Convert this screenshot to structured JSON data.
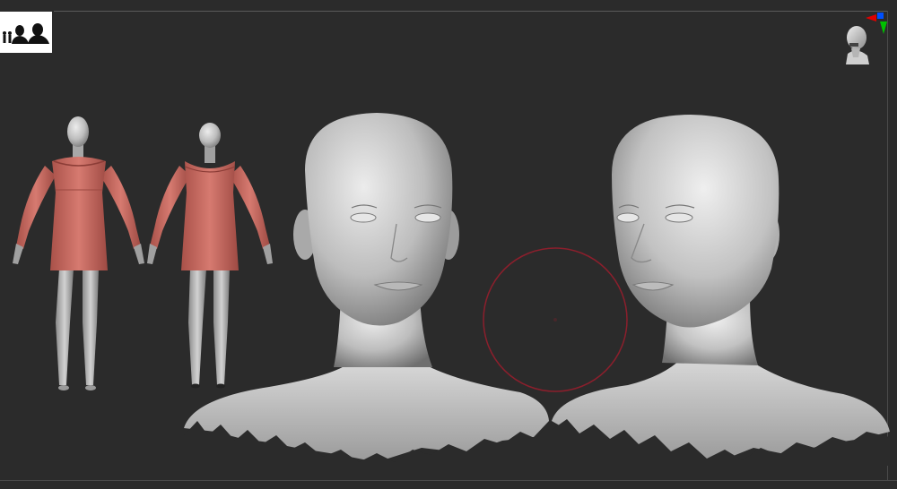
{
  "app": {
    "viewport_bg": "#2b2b2b",
    "accent_cloth": "#c96a63",
    "brush_cursor_color": "#8b1f2c"
  },
  "toolbar": {
    "logo_icon": "silhouettes-logo-icon"
  },
  "navigator": {
    "icon": "head-navigation-gizmo-icon",
    "axis_colors": {
      "x": "#e00000",
      "y": "#00c000",
      "z": "#0050ff"
    }
  },
  "scene": {
    "models": [
      {
        "name": "full-body-front",
        "dress_color": "#c96a63"
      },
      {
        "name": "full-body-back",
        "dress_color": "#c96a63"
      },
      {
        "name": "head-bust-front"
      },
      {
        "name": "head-bust-three-quarter"
      }
    ]
  }
}
